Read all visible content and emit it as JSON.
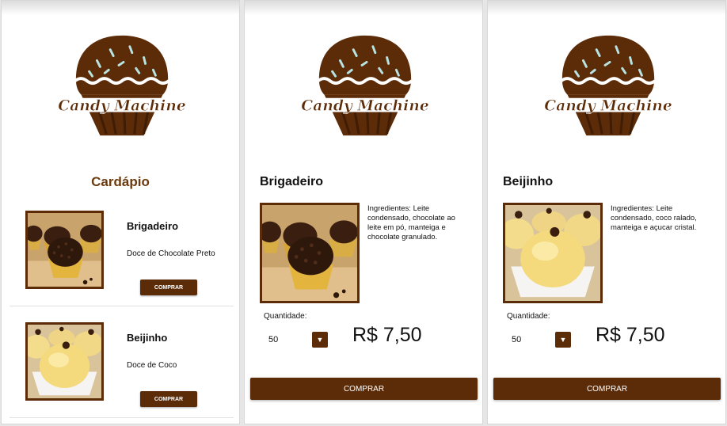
{
  "brand": {
    "logo_text": "Candy Machine"
  },
  "menu": {
    "title": "Cardápio",
    "items": [
      {
        "name": "Brigadeiro",
        "description": "Doce de Chocolate Preto",
        "button": "COMPRAR",
        "image_icon": "brigadeiro-image"
      },
      {
        "name": "Beijinho",
        "description": "Doce de Coco",
        "button": "COMPRAR",
        "image_icon": "beijinho-image"
      }
    ]
  },
  "details": [
    {
      "name": "Brigadeiro",
      "ingredients": "Ingredientes: Leite condensado, chocolate ao leite em pó, manteiga e chocolate granulado.",
      "quantity_label": "Quantidade:",
      "quantity_value": "50",
      "price": "R$ 7,50",
      "button": "COMPRAR"
    },
    {
      "name": "Beijinho",
      "ingredients": "Ingredientes: Leite condensado, coco ralado, manteiga e açucar cristal.",
      "quantity_label": "Quantidade:",
      "quantity_value": "50",
      "price": "R$ 7,50",
      "button": "COMPRAR"
    }
  ],
  "colors": {
    "accent": "#5c2b07",
    "title": "#6b3a0e"
  }
}
